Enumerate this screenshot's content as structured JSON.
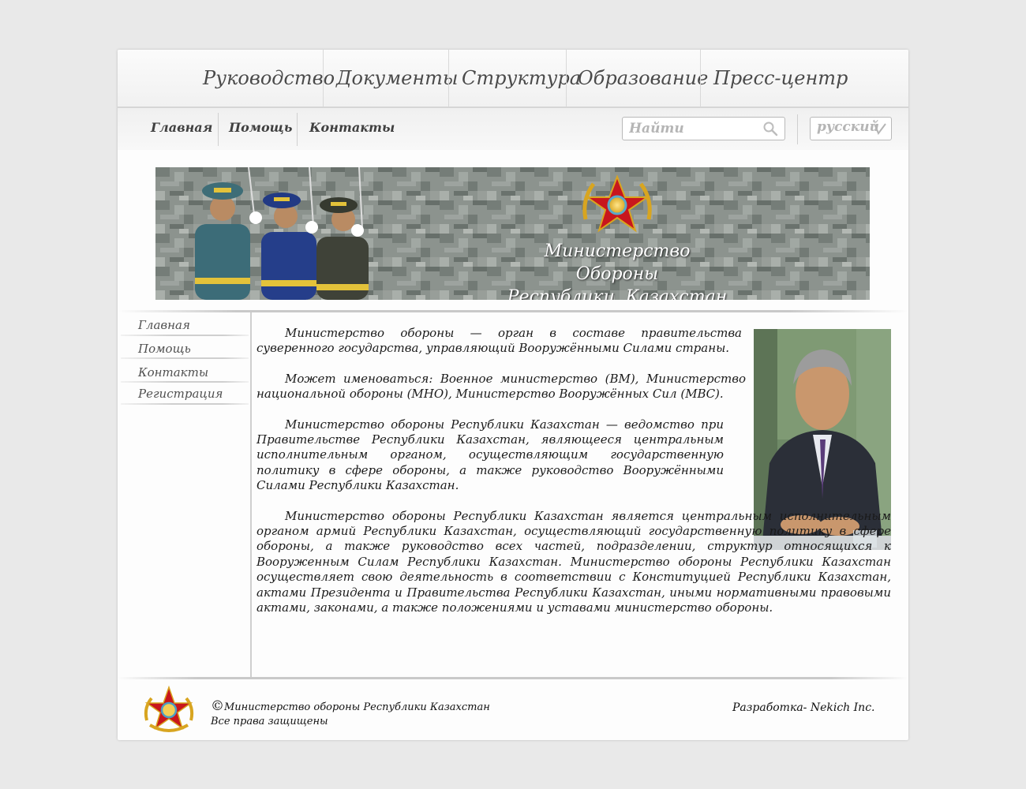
{
  "top_nav": {
    "items": [
      {
        "label": "Руководство"
      },
      {
        "label": "Документы"
      },
      {
        "label": "Структура"
      },
      {
        "label": "Образование"
      },
      {
        "label": "Пресс-центр"
      }
    ]
  },
  "sub_nav": {
    "items": [
      {
        "label": "Главная"
      },
      {
        "label": "Помощь"
      },
      {
        "label": "Контакты"
      }
    ],
    "search": {
      "placeholder": "Найти",
      "icon": "search-icon"
    },
    "language": {
      "selected": "русский",
      "icon": "chevron-down-icon"
    }
  },
  "banner": {
    "title_line1": "Министерство Обороны",
    "title_line2": "Республики ,Казахстан"
  },
  "sidebar": {
    "items": [
      {
        "label": "Главная"
      },
      {
        "label": "Помощь"
      },
      {
        "label": "Контакты"
      },
      {
        "label": "Регистрация"
      }
    ]
  },
  "content": {
    "paragraphs": [
      "Министерство обороны — орган в составе правительства суверенного государства, управляющий Вооружёнными Силами страны.",
      "Может именоваться: Военное министерство (ВМ), Министерство национальной обороны (МНО), Министерство Вооружённых Сил (МВС).",
      "Министерство обороны Республики Казахстан — ведомство при Правительстве Республики Казахстан, являющееся центральным исполнительным органом, осуществляющим государственную политику в сфере обороны, а также руководство Вооружёнными Силами Республики Казахстан.",
      "Министерство обороны Республики Казахстан является центральным исполнительным органом армий Республики Казахстан, осуществляющий государственную политику в сфере обороны, а также руководство всех частей, подразделении, структур относящихся к Вооруженным Силам Республики Казахстан. Министерство обороны Республики Казахстан осуществляет свою деятельность в соответствии с Конституцией Республики Казахстан, актами Президента и Правительства Республики Казахстан, иными нормативными правовыми актами, законами, а также положениями и уставами министерство обороны."
    ]
  },
  "footer": {
    "copyright_symbol": "©",
    "copyright_text": "Министерство обороны Республики Казахстан",
    "rights": "Все права защищены",
    "developer": "Разработка- Nekich Inc."
  },
  "colors": {
    "background": "#e9e9e9",
    "page": "#fdfdfd",
    "nav_text": "#4a4a4a",
    "star_red": "#c8161d",
    "emblem_gold": "#d8a520"
  }
}
